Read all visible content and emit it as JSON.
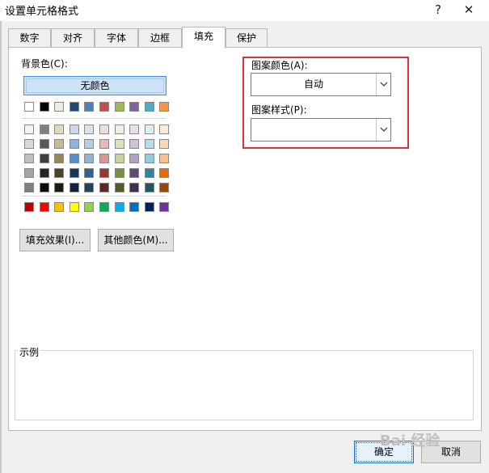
{
  "window": {
    "title": "设置单元格格式",
    "help": "?",
    "close": "✕"
  },
  "tabs": [
    {
      "label": "数字"
    },
    {
      "label": "对齐"
    },
    {
      "label": "字体"
    },
    {
      "label": "边框"
    },
    {
      "label": "填充",
      "active": true
    },
    {
      "label": "保护"
    }
  ],
  "background": {
    "label": "背景色(C):",
    "no_color": "无颜色",
    "theme_top": [
      "#ffffff",
      "#000000",
      "#eeece1",
      "#1f497d",
      "#4f81bd",
      "#c0504d",
      "#9bbb59",
      "#8064a2",
      "#4bacc6",
      "#f79646"
    ],
    "theme_tints": [
      [
        "#f2f2f2",
        "#7f7f7f",
        "#ddd9c3",
        "#c6d9f0",
        "#dbe5f1",
        "#f2dcdb",
        "#ebf1dd",
        "#e5e0ec",
        "#dbeef3",
        "#fdeada"
      ],
      [
        "#d8d8d8",
        "#595959",
        "#c4bd97",
        "#8db3e2",
        "#b8cce4",
        "#e5b9b7",
        "#d7e3bc",
        "#ccc1d9",
        "#b7dde8",
        "#fbd5b5"
      ],
      [
        "#bfbfbf",
        "#3f3f3f",
        "#938953",
        "#548dd4",
        "#95b3d7",
        "#d99694",
        "#c3d69b",
        "#b2a2c7",
        "#92cddc",
        "#fac08f"
      ],
      [
        "#a5a5a5",
        "#262626",
        "#494429",
        "#17365d",
        "#366092",
        "#953734",
        "#76923c",
        "#5f497a",
        "#31859b",
        "#e36c09"
      ],
      [
        "#7f7f7f",
        "#0c0c0c",
        "#1d1b10",
        "#0f243e",
        "#244061",
        "#632423",
        "#4f6128",
        "#3f3151",
        "#205867",
        "#974806"
      ]
    ],
    "standard": [
      "#c00000",
      "#ff0000",
      "#ffc000",
      "#ffff00",
      "#92d050",
      "#00b050",
      "#00b0f0",
      "#0070c0",
      "#002060",
      "#7030a0"
    ]
  },
  "buttons": {
    "fill_effects": "填充效果(I)...",
    "more_colors": "其他颜色(M)...",
    "ok": "确定",
    "cancel": "取消"
  },
  "pattern": {
    "color_label": "图案颜色(A):",
    "color_value": "自动",
    "style_label": "图案样式(P):",
    "style_value": ""
  },
  "sample": {
    "label": "示例"
  },
  "watermark": "Bai 经验",
  "colors": {
    "accent": "#0078d7",
    "highlight": "#e2303a",
    "selected": "#cce4f7"
  }
}
